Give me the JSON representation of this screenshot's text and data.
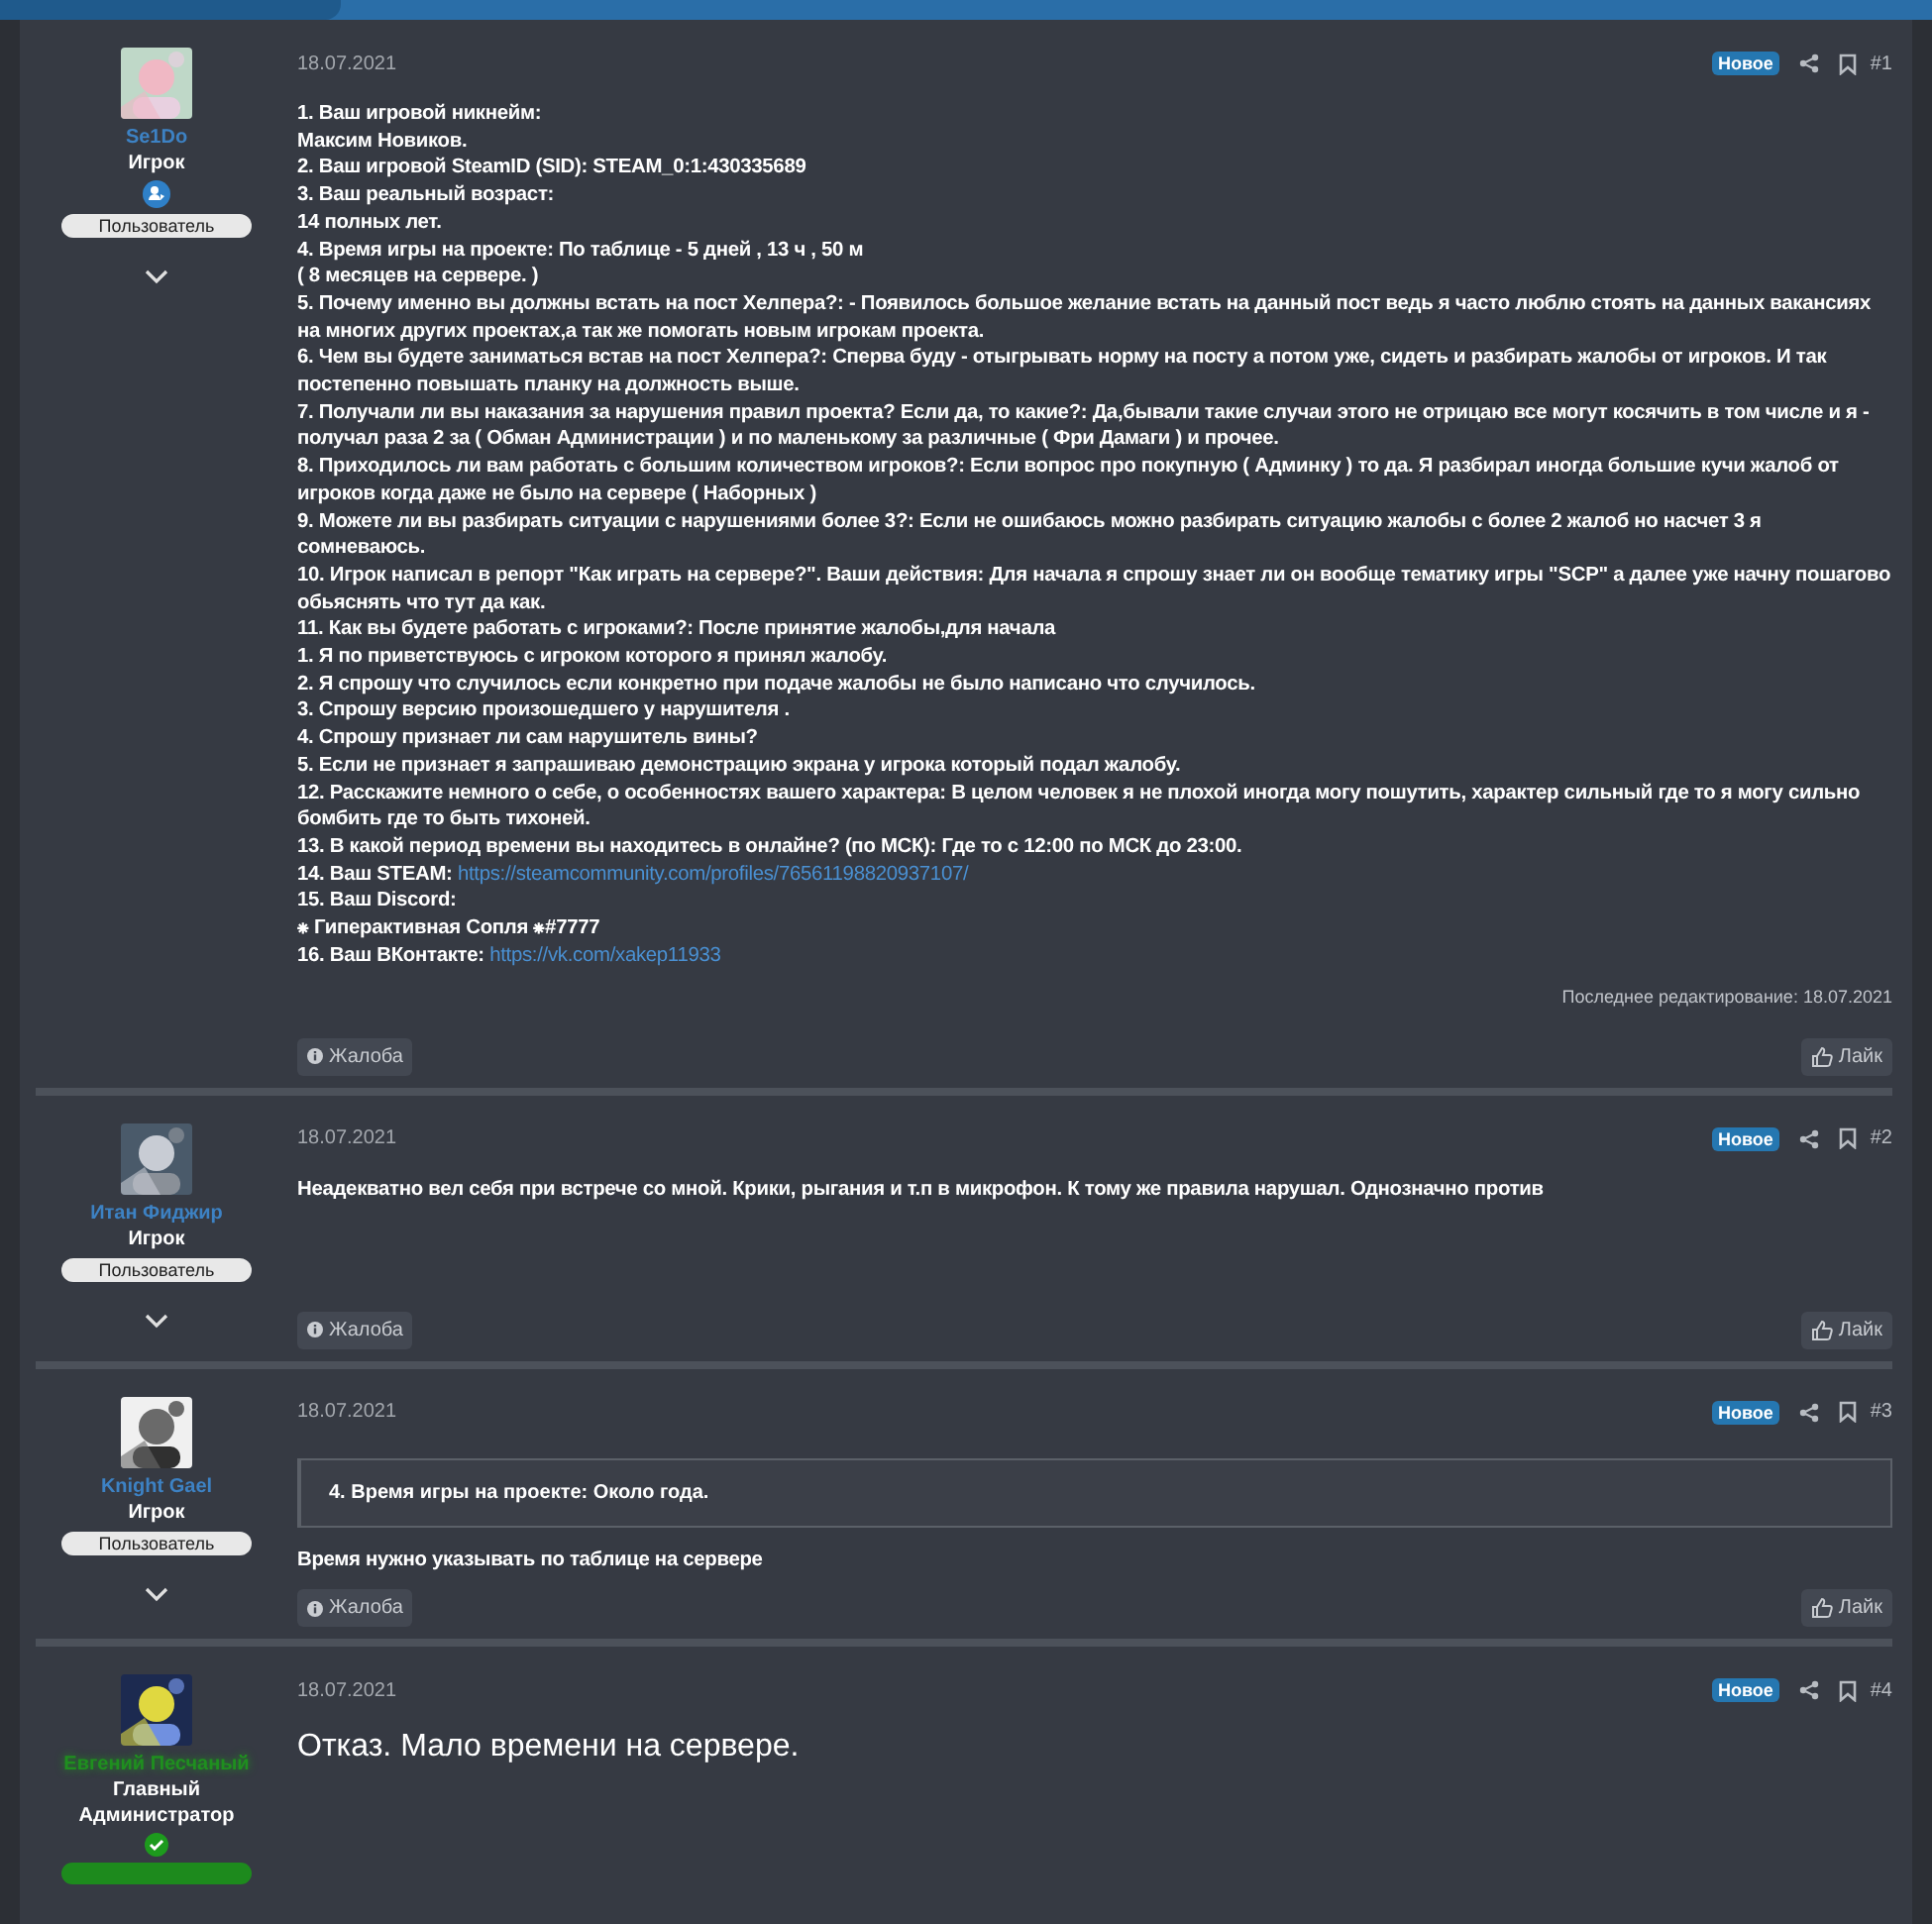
{
  "posts": [
    {
      "author": {
        "name": "Se1Do",
        "color": "#3d82c4",
        "title": "Игрок",
        "kind": "member",
        "role": {
          "label": "Пользователь",
          "color": "#e8e8e8"
        },
        "toggle": true
      },
      "date": "18.07.2021",
      "badge": "Новое",
      "number": "#1",
      "kind": "text",
      "lines": [
        {
          "text": "1. Ваш игровой никнейм:"
        },
        {
          "text": "Максим Новиков."
        },
        {
          "text": "2. Ваш игровой SteamID (SID): STEAM_0:1:430335689"
        },
        {
          "text": "3. Ваш реальный возраст:"
        },
        {
          "text": "14 полных лет."
        },
        {
          "text": "4. Время игры на проекте: По таблице - 5 дней , 13 ч , 50 м"
        },
        {
          "text": "( 8 месяцев на сервере. )"
        },
        {
          "text": "5. Почему именно вы должны встать на пост Хелпера?: - Появилось большое желание встать на данный пост ведь я часто люблю стоять на данных вакансиях на многих других проектах,а так же помогать новым игрокам проекта."
        },
        {
          "text": "6. Чем вы будете заниматься встав на пост Хелпера?: Сперва буду - отыгрывать норму на посту а потом уже, сидеть и разбирать жалобы от игроков. И так постепенно повышать планку на должность выше."
        },
        {
          "text": "7. Получали ли вы наказания за нарушения правил проекта? Если да, то какие?: Да,бывали такие случаи этого не отрицаю все могут косячить в том числе и я - получал раза 2 за ( Обман Администрации ) и по маленькому за различные ( Фри Дамаги ) и прочее."
        },
        {
          "text": "8. Приходилось ли вам работать с большим количеством игроков?: Если вопрос про покупную ( Админку ) то да. Я разбирал иногда большие кучи жалоб от игроков когда даже не было на сервере ( Наборных )"
        },
        {
          "text": "9. Можете ли вы разбирать ситуации с нарушениями более 3?: Если не ошибаюсь можно разбирать ситуацию жалобы с более 2 жалоб но насчет 3 я сомневаюсь."
        },
        {
          "text": "10. Игрок написал в репорт \"Как играть на сервере?\". Ваши действия: Для начала я спрошу знает ли он вообще тематику игры \"SCP\" а далее уже начну пошагово обьяснять что тут да как."
        },
        {
          "text": "11. Как вы будете работать с игроками?: После принятие жалобы,для начала"
        },
        {
          "text": "1. Я по приветствуюсь с игроком которого я принял жалобу."
        },
        {
          "text": "2. Я спрошу что случилось если конкретно при подаче жалобы не было написано что случилось."
        },
        {
          "text": "3. Спрошу версию произошедшего у нарушителя ."
        },
        {
          "text": "4. Спрошу признает ли сам нарушитель вины?"
        },
        {
          "text": "5. Если не признает я запрашиваю демонстрацию экрана у игрока который подал жалобу."
        },
        {
          "text": "12. Расскажите немного о себе, о особенностях вашего характера: В целом человек я не плохой иногда могу пошутить, характер сильный где то я могу сильно бомбить где то быть тихоней."
        },
        {
          "text": "13. В какой период времени вы находитесь в онлайне? (по МСК): Где то с 12:00 по МСК до 23:00."
        },
        {
          "text": "14. Ваш STEAM: ",
          "link": "https://steamcommunity.com/profiles/76561198820937107/"
        },
        {
          "text": "15. Ваш Discord:"
        },
        {
          "text": "⁕ Гиперактивная Сопля ⁕#7777"
        },
        {
          "text": "16. Ваш ВКонтакте: ",
          "link": "https://vk.com/xakep11933"
        }
      ],
      "edited": "Последнее редактирование: 18.07.2021",
      "report": "Жалоба",
      "like": "Лайк"
    },
    {
      "author": {
        "name": "Итан Фиджир",
        "color": "#3d82c4",
        "title": "Игрок",
        "role": {
          "label": "Пользователь",
          "color": "#e8e8e8"
        },
        "toggle": true
      },
      "date": "18.07.2021",
      "badge": "Новое",
      "number": "#2",
      "kind": "text",
      "lines": [
        {
          "text": "Неадекватно вел себя при встрече со мной. Крики, рыгания и т.п в микрофон. К тому же правила нарушал. Однозначно против"
        }
      ],
      "report": "Жалоба",
      "like": "Лайк"
    },
    {
      "author": {
        "name": "Knight Gael",
        "color": "#3d82c4",
        "title": "Игрок",
        "role": {
          "label": "Пользователь",
          "color": "#e8e8e8"
        },
        "toggle": true
      },
      "date": "18.07.2021",
      "badge": "Новое",
      "number": "#3",
      "kind": "text",
      "quote": "4. Время игры на проекте: Около года.",
      "lines": [
        {
          "text": "Время нужно указывать по таблице на сервере"
        }
      ],
      "report": "Жалоба",
      "like": "Лайк"
    },
    {
      "author": {
        "name": "Евгений Песчаный",
        "color": "#1f8f1f",
        "title": "Главный Администратор",
        "kind": "staff",
        "role": {
          "color": "#1d8a1d"
        },
        "toggle": false
      },
      "date": "18.07.2021",
      "badge": "Новое",
      "number": "#4",
      "kind": "large",
      "lines": [
        {
          "text": "Отказ. Мало времени на сервере."
        }
      ]
    }
  ]
}
